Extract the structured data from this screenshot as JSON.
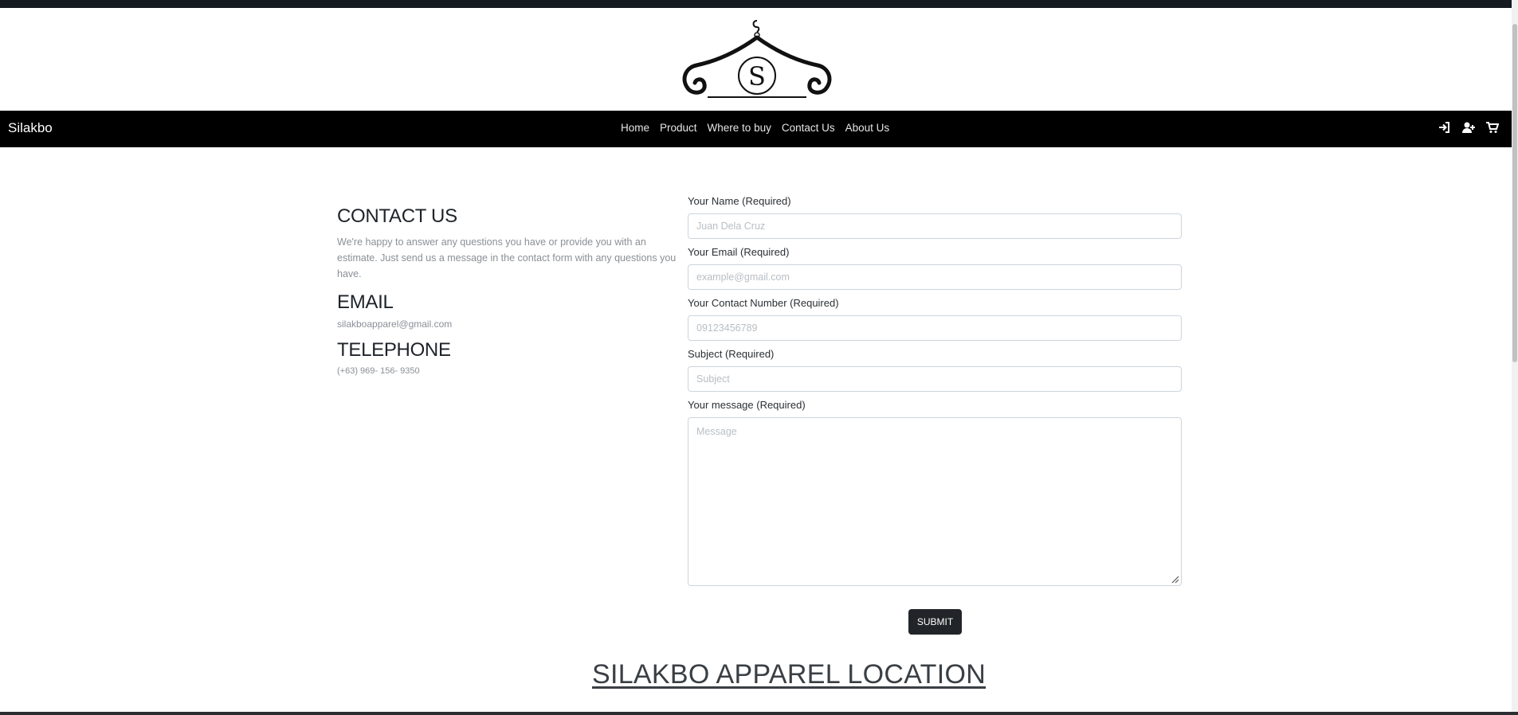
{
  "logo": {
    "icon": "hanger-s-logo-icon",
    "letter": "S"
  },
  "navbar": {
    "brand": "Silakbo",
    "links": [
      "Home",
      "Product",
      "Where to buy",
      "Contact Us",
      "About Us"
    ],
    "icons": [
      "sign-in-icon",
      "add-user-icon",
      "cart-icon"
    ]
  },
  "contact_info": {
    "heading": "CONTACT US",
    "description": "We're happy to answer any questions you have or provide you with an estimate. Just send us a message in the contact form with any questions you have.",
    "email_heading": "EMAIL",
    "email": "silakboapparel@gmail.com",
    "telephone_heading": "TELEPHONE",
    "telephone": "(+63) 969- 156- 9350"
  },
  "form": {
    "name_label": "Your Name (Required)",
    "name_placeholder": "Juan Dela Cruz",
    "email_label": "Your Email (Required)",
    "email_placeholder": "example@gmail.com",
    "contact_label": "Your Contact Number (Required)",
    "contact_placeholder": "09123456789",
    "subject_label": "Subject (Required)",
    "subject_placeholder": "Subject",
    "message_label": "Your message (Required)",
    "message_placeholder": "Message",
    "submit_label": "SUBMIT"
  },
  "location": {
    "title": "SILAKBO APPAREL LOCATION"
  },
  "colors": {
    "navbar": "#000000",
    "button": "#212529",
    "muted_text": "#8a8f95"
  }
}
